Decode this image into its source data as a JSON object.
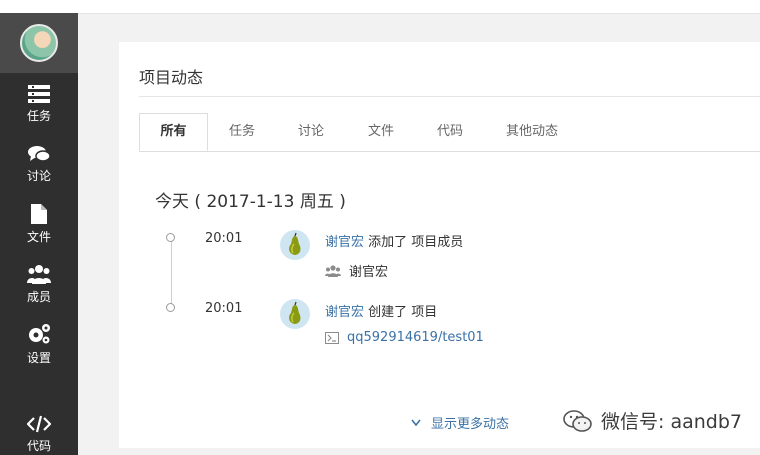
{
  "sidebar": {
    "items": [
      {
        "label": "任务",
        "icon": "tasks-icon"
      },
      {
        "label": "讨论",
        "icon": "comments-icon"
      },
      {
        "label": "文件",
        "icon": "file-icon"
      },
      {
        "label": "成员",
        "icon": "users-icon"
      },
      {
        "label": "设置",
        "icon": "cogs-icon"
      },
      {
        "label": "代码",
        "icon": "code-icon"
      }
    ]
  },
  "panel": {
    "title": "项目动态",
    "tabs": [
      {
        "label": "所有",
        "active": true
      },
      {
        "label": "任务",
        "active": false
      },
      {
        "label": "讨论",
        "active": false
      },
      {
        "label": "文件",
        "active": false
      },
      {
        "label": "代码",
        "active": false
      },
      {
        "label": "其他动态",
        "active": false
      }
    ],
    "day_heading": "今天 ( 2017-1-13 周五 )",
    "events": [
      {
        "time": "20:01",
        "user": "谢官宏",
        "action": "添加了 项目成员",
        "detail": "谢官宏",
        "detail_icon": "users-icon"
      },
      {
        "time": "20:01",
        "user": "谢官宏",
        "action": "创建了 项目",
        "detail": "qq592914619/test01",
        "detail_icon": "repo-icon"
      }
    ],
    "show_more": "显示更多动态"
  },
  "watermark": "微信号: aandb7",
  "colors": {
    "sidebar_bg": "#2f2f2f",
    "link": "#3a72a6",
    "content_bg": "#ffffff",
    "page_bg": "#f2f2f2"
  }
}
